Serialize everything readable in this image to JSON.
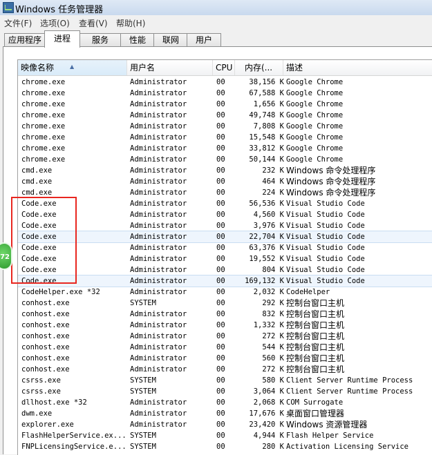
{
  "window": {
    "title": "Windows 任务管理器"
  },
  "menu": [
    {
      "label": "文件(F)"
    },
    {
      "label": "选项(O)"
    },
    {
      "label": "查看(V)"
    },
    {
      "label": "帮助(H)"
    }
  ],
  "tabs": [
    {
      "label": "应用程序"
    },
    {
      "label": "进程"
    },
    {
      "label": "服务"
    },
    {
      "label": "性能"
    },
    {
      "label": "联网"
    },
    {
      "label": "用户"
    }
  ],
  "columns": {
    "name": "映像名称",
    "user": "用户名",
    "cpu": "CPU",
    "mem": "内存(...",
    "desc": "描述"
  },
  "badge": "72",
  "processes": [
    {
      "name": "chrome.exe",
      "user": "Administrator",
      "cpu": "00",
      "mem": "38,156 K",
      "desc": "Google Chrome"
    },
    {
      "name": "chrome.exe",
      "user": "Administrator",
      "cpu": "00",
      "mem": "67,588 K",
      "desc": "Google Chrome"
    },
    {
      "name": "chrome.exe",
      "user": "Administrator",
      "cpu": "00",
      "mem": "1,656 K",
      "desc": "Google Chrome"
    },
    {
      "name": "chrome.exe",
      "user": "Administrator",
      "cpu": "00",
      "mem": "49,748 K",
      "desc": "Google Chrome"
    },
    {
      "name": "chrome.exe",
      "user": "Administrator",
      "cpu": "00",
      "mem": "7,808 K",
      "desc": "Google Chrome"
    },
    {
      "name": "chrome.exe",
      "user": "Administrator",
      "cpu": "00",
      "mem": "15,548 K",
      "desc": "Google Chrome"
    },
    {
      "name": "chrome.exe",
      "user": "Administrator",
      "cpu": "00",
      "mem": "33,812 K",
      "desc": "Google Chrome"
    },
    {
      "name": "chrome.exe",
      "user": "Administrator",
      "cpu": "00",
      "mem": "50,144 K",
      "desc": "Google Chrome"
    },
    {
      "name": "cmd.exe",
      "user": "Administrator",
      "cpu": "00",
      "mem": "232 K",
      "desc": "Windows 命令处理程序"
    },
    {
      "name": "cmd.exe",
      "user": "Administrator",
      "cpu": "00",
      "mem": "464 K",
      "desc": "Windows 命令处理程序"
    },
    {
      "name": "cmd.exe",
      "user": "Administrator",
      "cpu": "00",
      "mem": "224 K",
      "desc": "Windows 命令处理程序"
    },
    {
      "name": "Code.exe",
      "user": "Administrator",
      "cpu": "00",
      "mem": "56,536 K",
      "desc": "Visual Studio Code"
    },
    {
      "name": "Code.exe",
      "user": "Administrator",
      "cpu": "00",
      "mem": "4,560 K",
      "desc": "Visual Studio Code"
    },
    {
      "name": "Code.exe",
      "user": "Administrator",
      "cpu": "00",
      "mem": "3,976 K",
      "desc": "Visual Studio Code"
    },
    {
      "name": "Code.exe",
      "user": "Administrator",
      "cpu": "00",
      "mem": "22,704 K",
      "desc": "Visual Studio Code"
    },
    {
      "name": "Code.exe",
      "user": "Administrator",
      "cpu": "00",
      "mem": "63,376 K",
      "desc": "Visual Studio Code"
    },
    {
      "name": "Code.exe",
      "user": "Administrator",
      "cpu": "00",
      "mem": "19,552 K",
      "desc": "Visual Studio Code"
    },
    {
      "name": "Code.exe",
      "user": "Administrator",
      "cpu": "00",
      "mem": "804 K",
      "desc": "Visual Studio Code"
    },
    {
      "name": "Code.exe",
      "user": "Administrator",
      "cpu": "00",
      "mem": "169,132 K",
      "desc": "Visual Studio Code"
    },
    {
      "name": "CodeHelper.exe *32",
      "user": "Administrator",
      "cpu": "00",
      "mem": "2,032 K",
      "desc": "CodeHelper"
    },
    {
      "name": "conhost.exe",
      "user": "SYSTEM",
      "cpu": "00",
      "mem": "292 K",
      "desc": "控制台窗口主机"
    },
    {
      "name": "conhost.exe",
      "user": "Administrator",
      "cpu": "00",
      "mem": "832 K",
      "desc": "控制台窗口主机"
    },
    {
      "name": "conhost.exe",
      "user": "Administrator",
      "cpu": "00",
      "mem": "1,332 K",
      "desc": "控制台窗口主机"
    },
    {
      "name": "conhost.exe",
      "user": "Administrator",
      "cpu": "00",
      "mem": "272 K",
      "desc": "控制台窗口主机"
    },
    {
      "name": "conhost.exe",
      "user": "Administrator",
      "cpu": "00",
      "mem": "544 K",
      "desc": "控制台窗口主机"
    },
    {
      "name": "conhost.exe",
      "user": "Administrator",
      "cpu": "00",
      "mem": "560 K",
      "desc": "控制台窗口主机"
    },
    {
      "name": "conhost.exe",
      "user": "Administrator",
      "cpu": "00",
      "mem": "272 K",
      "desc": "控制台窗口主机"
    },
    {
      "name": "csrss.exe",
      "user": "SYSTEM",
      "cpu": "00",
      "mem": "580 K",
      "desc": "Client Server Runtime Process"
    },
    {
      "name": "csrss.exe",
      "user": "SYSTEM",
      "cpu": "00",
      "mem": "3,064 K",
      "desc": "Client Server Runtime Process"
    },
    {
      "name": "dllhost.exe *32",
      "user": "Administrator",
      "cpu": "00",
      "mem": "2,068 K",
      "desc": "COM Surrogate"
    },
    {
      "name": "dwm.exe",
      "user": "Administrator",
      "cpu": "00",
      "mem": "17,676 K",
      "desc": "桌面窗口管理器"
    },
    {
      "name": "explorer.exe",
      "user": "Administrator",
      "cpu": "00",
      "mem": "23,420 K",
      "desc": "Windows 资源管理器"
    },
    {
      "name": "FlashHelperService.ex...",
      "user": "SYSTEM",
      "cpu": "00",
      "mem": "4,944 K",
      "desc": "Flash Helper Service"
    },
    {
      "name": "FNPLicensingService.e...",
      "user": "SYSTEM",
      "cpu": "00",
      "mem": "280 K",
      "desc": "Activation Licensing Service"
    }
  ]
}
